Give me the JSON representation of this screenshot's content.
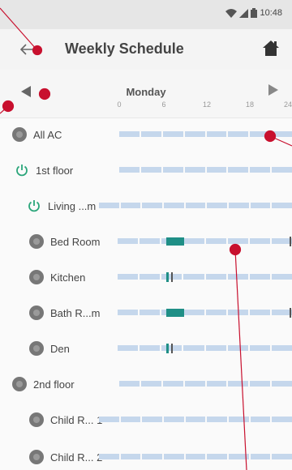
{
  "status_bar": {
    "time": "10:48",
    "icons": [
      "wifi-icon",
      "signal-icon",
      "battery-icon"
    ]
  },
  "header": {
    "back_icon": "arrow-left-icon",
    "title": "Weekly Schedule",
    "home_icon": "home-icon"
  },
  "day_nav": {
    "day": "Monday",
    "ticks": [
      "0",
      "6",
      "12",
      "18",
      "24"
    ]
  },
  "rows": [
    {
      "label": "All AC"
    },
    {
      "label": "1st floor"
    },
    {
      "label": "Living ...m"
    },
    {
      "label": "Bed Room"
    },
    {
      "label": "Kitchen"
    },
    {
      "label": "Bath R...m"
    },
    {
      "label": "Den"
    },
    {
      "label": "2nd floor"
    },
    {
      "label": "Child R... 1"
    },
    {
      "label": "Child R... 2"
    }
  ],
  "colors": {
    "track": "#c5d7ec",
    "schedule_on": "#1f8f86",
    "annotation": "#c8102e"
  }
}
